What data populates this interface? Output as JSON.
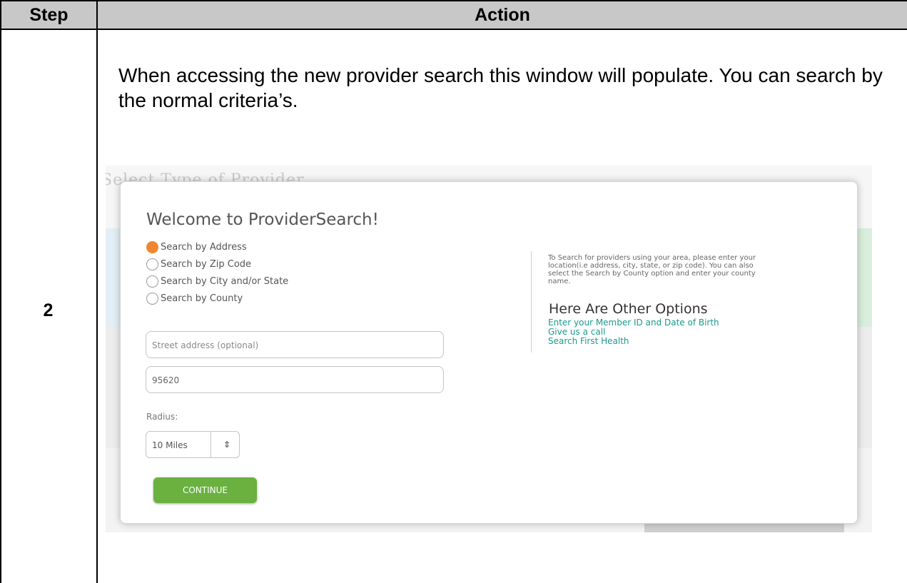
{
  "table": {
    "header_step": "Step",
    "header_action": "Action",
    "step_number": "2",
    "instruction": "When accessing the new provider search this window will populate. You can search by the normal criteria’s."
  },
  "screenshot": {
    "background_title": "Select Type of Provider",
    "modal": {
      "title": "Welcome to ProviderSearch!",
      "radio_options": [
        {
          "label": "Search by Address",
          "checked": true
        },
        {
          "label": "Search by Zip Code",
          "checked": false
        },
        {
          "label": "Search by City and/or State",
          "checked": false
        },
        {
          "label": "Search by County",
          "checked": false
        }
      ],
      "street_placeholder": "Street address (optional)",
      "zip_value": "95620",
      "radius_label": "Radius:",
      "radius_value": "10 Miles",
      "continue_label": "CONTINUE",
      "help_text": "To Search for providers using your area, please enter your location(i.e address, city, state, or zip code). You can also select the Search by County option and enter your county name.",
      "other_options_title": "Here Are Other Options",
      "other_links": [
        "Enter your Member ID and Date of Birth",
        "Give us a call",
        "Search First Health"
      ]
    }
  },
  "colors": {
    "accent_orange": "#f0862f",
    "button_green": "#6ab140",
    "link_teal": "#1a9a8a",
    "header_gray": "#c8c8c8"
  }
}
